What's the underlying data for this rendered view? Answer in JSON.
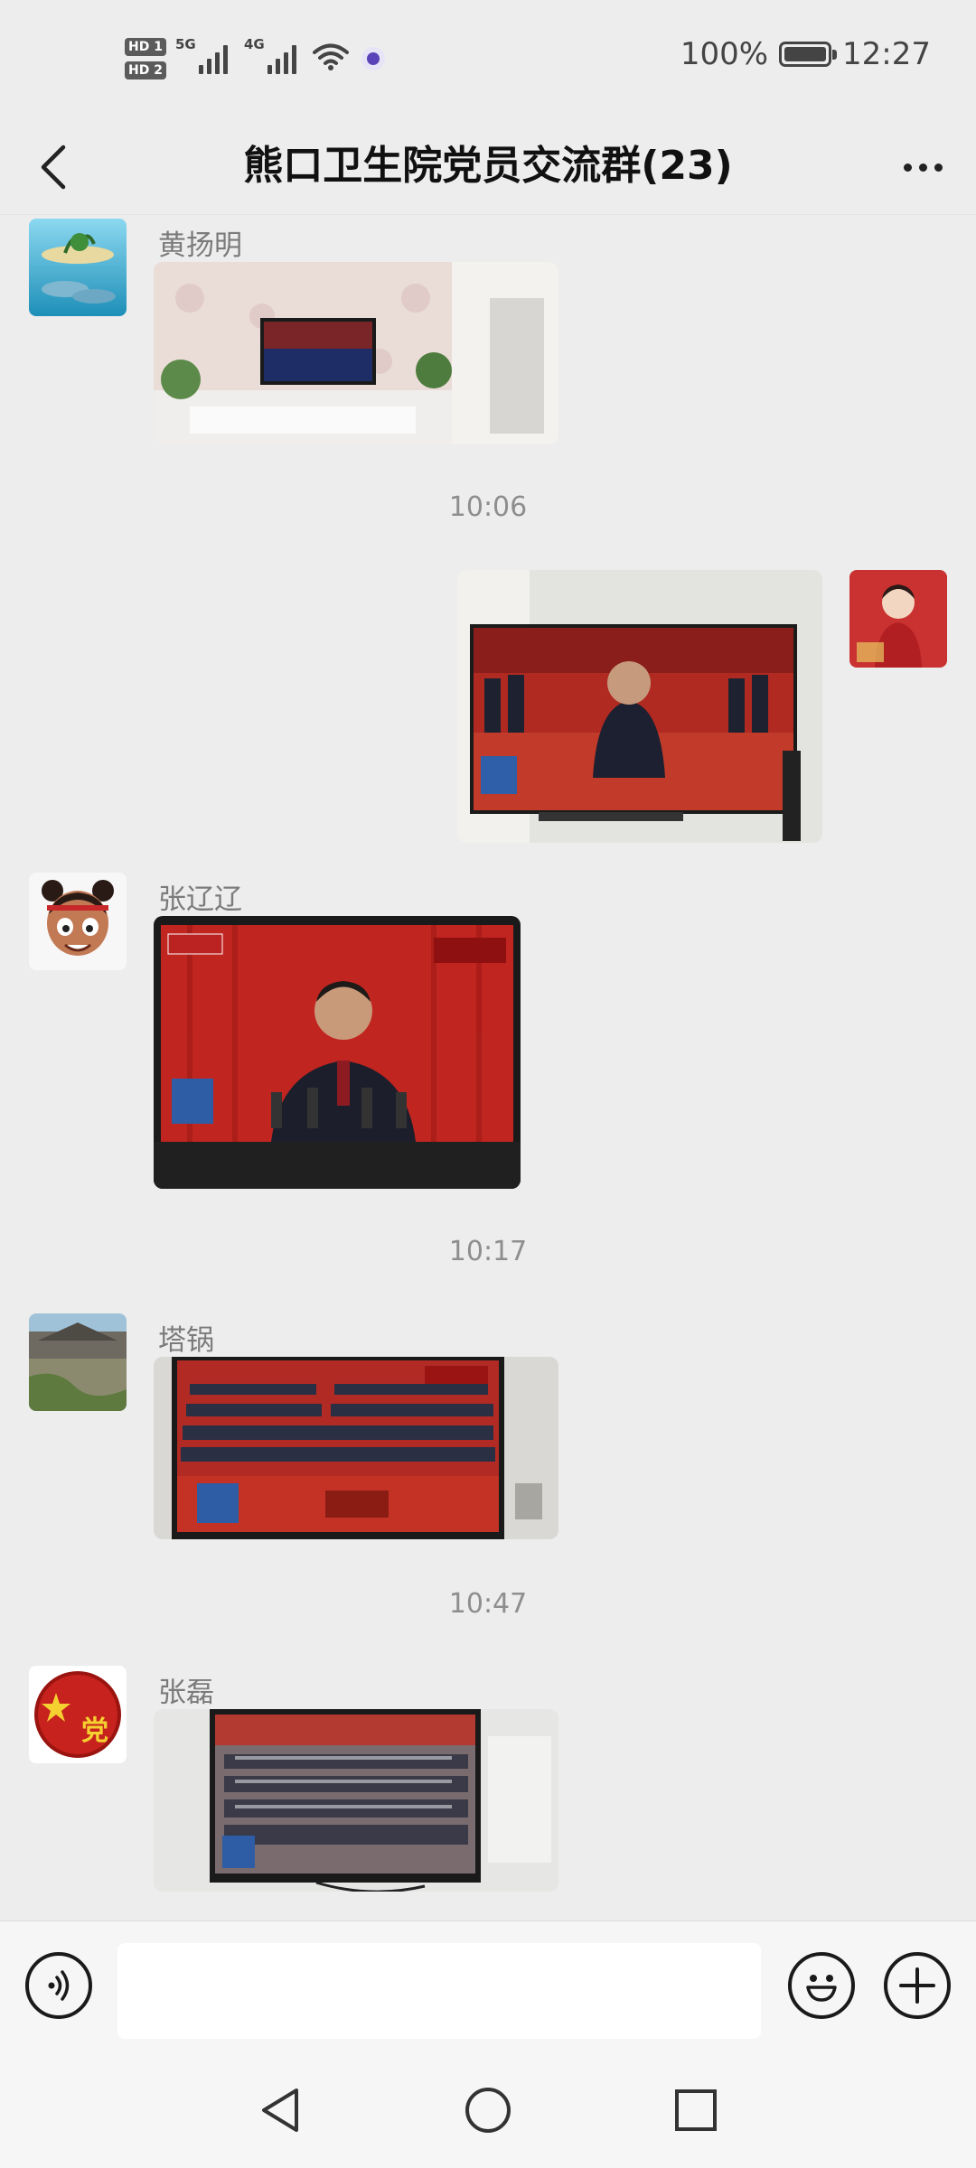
{
  "status_bar": {
    "hd1": "HD 1",
    "hd2": "HD 2",
    "sim1_network": "5G",
    "sim2_network": "4G",
    "battery_text": "100%",
    "time": "12:27"
  },
  "header": {
    "title": "熊口卫生院党员交流群(23)",
    "back_icon": "chevron-left-icon",
    "more_icon": "more-dots-icon"
  },
  "messages": [
    {
      "type": "image",
      "sender": "黄扬明",
      "side": "left",
      "image_desc": "living room TV showing congress hall"
    },
    {
      "type": "time",
      "text": "10:06"
    },
    {
      "type": "image",
      "sender": "",
      "side": "right",
      "image_desc": "TV showing leader on red stage"
    },
    {
      "type": "image",
      "sender": "张辽辽",
      "side": "left",
      "image_desc": "monitor showing speaker at podium"
    },
    {
      "type": "time",
      "text": "10:17"
    },
    {
      "type": "image",
      "sender": "塔锅",
      "side": "left",
      "image_desc": "TV showing congress hall wide view"
    },
    {
      "type": "time",
      "text": "10:47"
    },
    {
      "type": "image",
      "sender": "张磊",
      "side": "left",
      "image_desc": "wall TV showing congress audience"
    }
  ],
  "input_bar": {
    "voice_icon": "voice-icon",
    "emoji_icon": "emoji-icon",
    "plus_icon": "plus-icon",
    "input_value": ""
  },
  "system_nav": {
    "back": "triangle-back-icon",
    "home": "circle-home-icon",
    "recents": "square-recents-icon"
  }
}
